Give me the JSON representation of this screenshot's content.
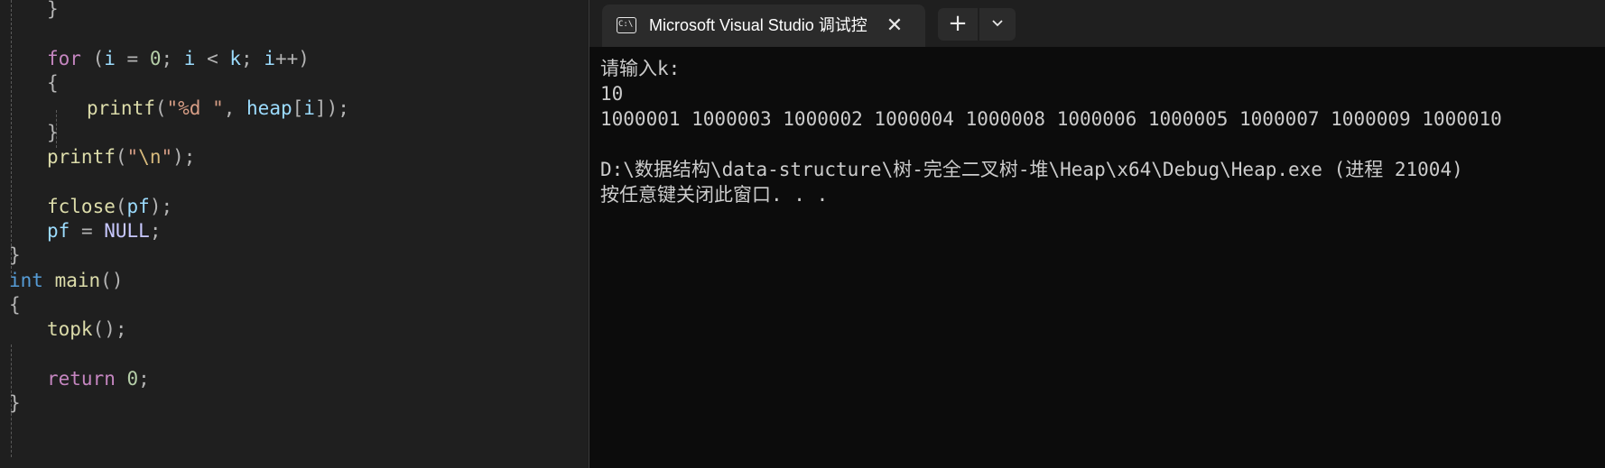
{
  "editor": {
    "lines": [
      {
        "tokens": [
          [
            "pun",
            "}"
          ]
        ]
      },
      {
        "tokens": []
      },
      {
        "tokens": [
          [
            "ctl",
            "for"
          ],
          [
            "pun",
            " ("
          ],
          [
            "var",
            "i"
          ],
          [
            "pun",
            " = "
          ],
          [
            "num",
            "0"
          ],
          [
            "pun",
            "; "
          ],
          [
            "var",
            "i"
          ],
          [
            "pun",
            " < "
          ],
          [
            "var",
            "k"
          ],
          [
            "pun",
            "; "
          ],
          [
            "var",
            "i"
          ],
          [
            "pun",
            "++)"
          ]
        ]
      },
      {
        "tokens": [
          [
            "pun",
            "{"
          ]
        ]
      },
      {
        "tokens": [
          [
            "fn",
            "printf"
          ],
          [
            "pun",
            "("
          ],
          [
            "str",
            "\"%d \""
          ],
          [
            "pun",
            ", "
          ],
          [
            "var",
            "heap"
          ],
          [
            "pun",
            "["
          ],
          [
            "var",
            "i"
          ],
          [
            "pun",
            "]);"
          ]
        ]
      },
      {
        "tokens": [
          [
            "pun",
            "}"
          ]
        ]
      },
      {
        "tokens": [
          [
            "fn",
            "printf"
          ],
          [
            "pun",
            "("
          ],
          [
            "str",
            "\""
          ],
          [
            "esc",
            "\\n"
          ],
          [
            "str",
            "\""
          ],
          [
            "pun",
            ");"
          ]
        ]
      },
      {
        "tokens": []
      },
      {
        "tokens": [
          [
            "fn",
            "fclose"
          ],
          [
            "pun",
            "("
          ],
          [
            "var",
            "pf"
          ],
          [
            "pun",
            ");"
          ]
        ]
      },
      {
        "tokens": [
          [
            "var",
            "pf"
          ],
          [
            "pun",
            " = "
          ],
          [
            "mac",
            "NULL"
          ],
          [
            "pun",
            ";"
          ]
        ]
      },
      {
        "tokens": [
          [
            "pun",
            "}"
          ]
        ]
      },
      {
        "tokens": [
          [
            "kw",
            "int"
          ],
          [
            "pun",
            " "
          ],
          [
            "fn",
            "main"
          ],
          [
            "pun",
            "()"
          ]
        ]
      },
      {
        "tokens": [
          [
            "pun",
            "{"
          ]
        ]
      },
      {
        "tokens": [
          [
            "fn",
            "topk"
          ],
          [
            "pun",
            "();"
          ]
        ]
      },
      {
        "tokens": []
      },
      {
        "tokens": [
          [
            "ctl",
            "return"
          ],
          [
            "pun",
            " "
          ],
          [
            "num",
            "0"
          ],
          [
            "pun",
            ";"
          ]
        ]
      },
      {
        "tokens": [
          [
            "pun",
            "}"
          ]
        ]
      }
    ]
  },
  "terminal": {
    "tab_title": "Microsoft Visual Studio 调试控",
    "tab_icon_text": "C:\\",
    "close_glyph": "✕",
    "new_tab_glyph": "+",
    "output": [
      "请输入k:",
      "10",
      "1000001 1000003 1000002 1000004 1000008 1000006 1000005 1000007 1000009 1000010",
      "",
      "D:\\数据结构\\data-structure\\树-完全二叉树-堆\\Heap\\x64\\Debug\\Heap.exe (进程 21004)",
      "按任意键关闭此窗口. . ."
    ]
  }
}
